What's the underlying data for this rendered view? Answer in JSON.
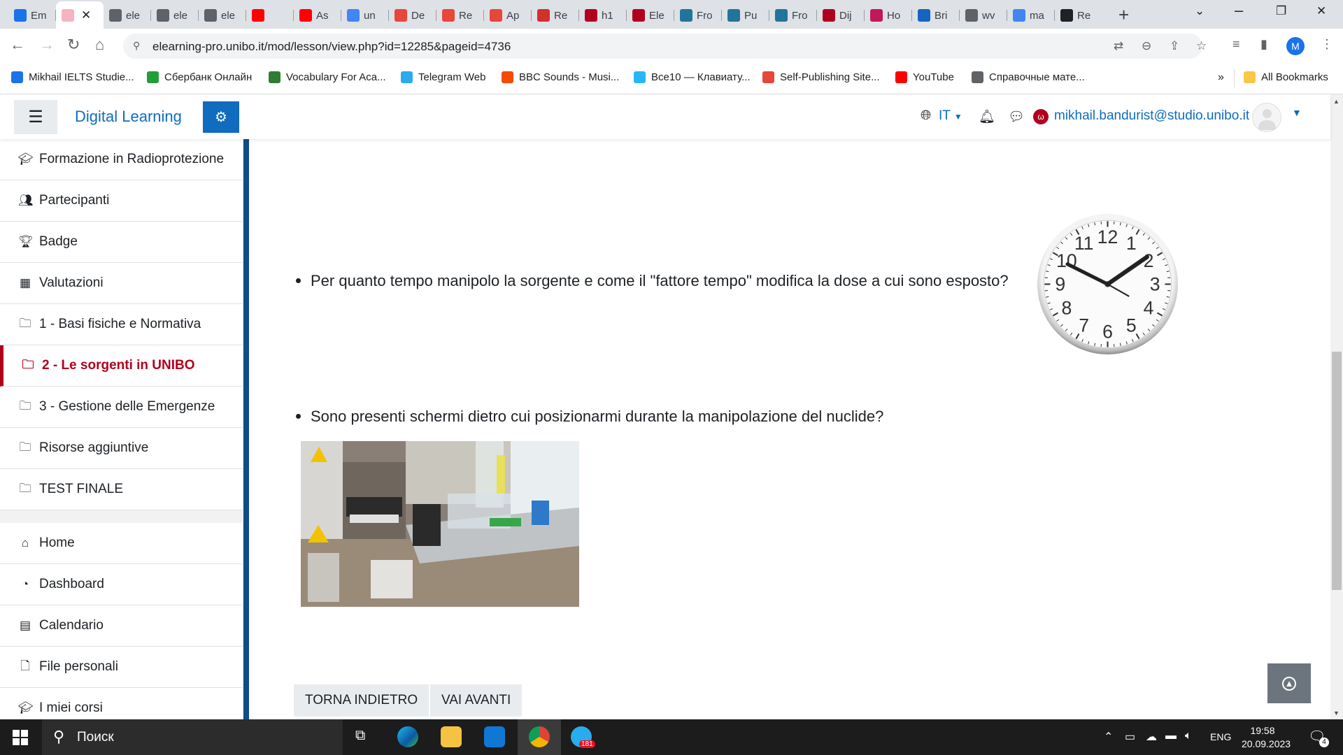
{
  "browser": {
    "tabs": [
      {
        "label": "Em",
        "color": "#1a73e8"
      },
      {
        "label": "",
        "color": "#f4b5c0",
        "active": true
      },
      {
        "label": "ele",
        "color": "#5f6368"
      },
      {
        "label": "ele",
        "color": "#5f6368"
      },
      {
        "label": "ele",
        "color": "#5f6368"
      },
      {
        "label": "",
        "color": "#ff0000"
      },
      {
        "label": "As",
        "color": "#ff0000"
      },
      {
        "label": "un",
        "color": "#4285f4"
      },
      {
        "label": "De",
        "color": "#e8453c"
      },
      {
        "label": "Re",
        "color": "#e8453c"
      },
      {
        "label": "Ap",
        "color": "#e8453c"
      },
      {
        "label": "Re",
        "color": "#d32f2f"
      },
      {
        "label": "h1",
        "color": "#b1001e"
      },
      {
        "label": "Ele",
        "color": "#b1001e"
      },
      {
        "label": "Fro",
        "color": "#21759b"
      },
      {
        "label": "Pu",
        "color": "#21759b"
      },
      {
        "label": "Fro",
        "color": "#21759b"
      },
      {
        "label": "Dij",
        "color": "#b1001e"
      },
      {
        "label": "Ho",
        "color": "#c2185b"
      },
      {
        "label": "Bri",
        "color": "#1565c0"
      },
      {
        "label": "wv",
        "color": "#5f6368"
      },
      {
        "label": "ma",
        "color": "#4285f4"
      },
      {
        "label": "Re",
        "color": "#202124"
      }
    ],
    "tab_close": "✕",
    "new_tab": "+",
    "url": "elearning-pro.unibo.it/mod/lesson/view.php?id=12285&pageid=4736",
    "profile_initial": "M"
  },
  "bookmarks": [
    {
      "label": "Mikhail IELTS Studie...",
      "color": "#1a73e8"
    },
    {
      "label": "Сбербанк Онлайн",
      "color": "#21a038"
    },
    {
      "label": "Vocabulary For Aca...",
      "color": "#2e7d32"
    },
    {
      "label": "Telegram Web",
      "color": "#2aabee"
    },
    {
      "label": "BBC Sounds - Musi...",
      "color": "#f54b00"
    },
    {
      "label": "Все10 — Клавиату...",
      "color": "#29b6f6"
    },
    {
      "label": "Self-Publishing Site...",
      "color": "#e8453c"
    },
    {
      "label": "YouTube",
      "color": "#ff0000"
    },
    {
      "label": "Справочные мате...",
      "color": "#5f6368"
    }
  ],
  "bookmarks_overflow": "»",
  "all_bookmarks": "All Bookmarks",
  "moodle": {
    "site_name": "Digital Learning",
    "lang": "IT",
    "user_email": "mikhail.bandurist@studio.unibo.it",
    "brand_color": "#0f6cbf",
    "active_color": "#b1001e"
  },
  "drawer": {
    "course_items": [
      {
        "label": "Formazione in Radioprotezione",
        "icon": "graduation-cap-icon"
      },
      {
        "label": "Partecipanti",
        "icon": "users-icon"
      },
      {
        "label": "Badge",
        "icon": "trophy-icon"
      },
      {
        "label": "Valutazioni",
        "icon": "table-icon"
      },
      {
        "label": "1 - Basi fisiche e Normativa",
        "icon": "folder-icon"
      },
      {
        "label": "2 - Le sorgenti in UNIBO",
        "icon": "folder-icon",
        "active": true
      },
      {
        "label": "3 - Gestione delle Emergenze",
        "icon": "folder-icon"
      },
      {
        "label": "Risorse aggiuntive",
        "icon": "folder-icon"
      },
      {
        "label": "TEST FINALE",
        "icon": "folder-icon"
      }
    ],
    "site_items": [
      {
        "label": "Home",
        "icon": "home-icon"
      },
      {
        "label": "Dashboard",
        "icon": "dashboard-icon"
      },
      {
        "label": "Calendario",
        "icon": "calendar-icon"
      },
      {
        "label": "File personali",
        "icon": "file-icon"
      },
      {
        "label": "I miei corsi",
        "icon": "graduation-cap-icon"
      }
    ]
  },
  "content": {
    "bullet_1": "Per quanto tempo manipolo la sorgente e come il \"fattore tempo\" modifica la dose a cui sono esposto?",
    "bullet_2": "Sono presenti schermi dietro cui posizionarmi durante la manipolazione del nuclide?",
    "clock_numbers": [
      "12",
      "1",
      "2",
      "3",
      "4",
      "5",
      "6",
      "7",
      "8",
      "9",
      "10",
      "11"
    ],
    "btn_back": "TORNA INDIETRO",
    "btn_next": "VAI AVANTI"
  },
  "taskbar": {
    "search_placeholder": "Поиск",
    "lang": "ENG",
    "time": "19:58",
    "date": "20.09.2023",
    "telegram_badge": "181",
    "notif_count": "4"
  }
}
